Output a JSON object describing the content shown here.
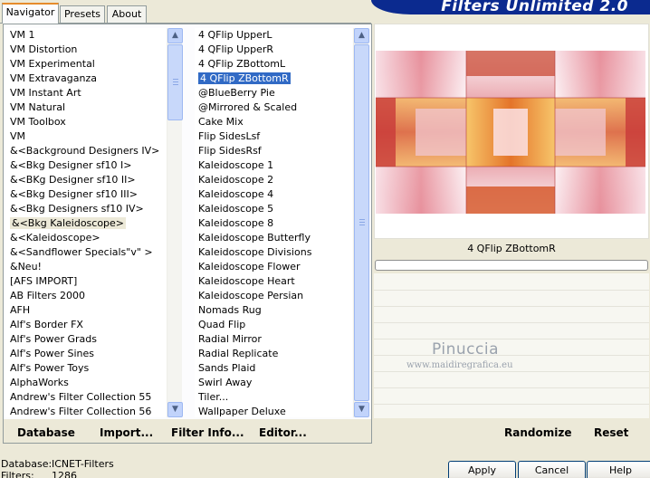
{
  "tabs": [
    "Navigator",
    "Presets",
    "About"
  ],
  "banner_title": "Filters Unlimited 2.0",
  "categories": [
    "VM 1",
    "VM Distortion",
    "VM Experimental",
    "VM Extravaganza",
    "VM Instant Art",
    "VM Natural",
    "VM Toolbox",
    "VM",
    "&<Background Designers IV>",
    "&<Bkg Designer sf10 I>",
    "&<BKg Designer sf10 II>",
    "&<Bkg Designer sf10 III>",
    "&<Bkg Designers sf10 IV>",
    "&<Bkg Kaleidoscope>",
    "&<Kaleidoscope>",
    "&<Sandflower Specials\"v\" >",
    "&Neu!",
    "[AFS IMPORT]",
    "AB Filters 2000",
    "AFH",
    "Alf's Border FX",
    "Alf's Power Grads",
    "Alf's Power Sines",
    "Alf's Power Toys",
    "AlphaWorks",
    "Andrew's Filter Collection 55",
    "Andrew's Filter Collection 56"
  ],
  "selected_category": "&<Bkg Kaleidoscope>",
  "filters": [
    "4 QFlip UpperL",
    "4 QFlip UpperR",
    "4 QFlip ZBottomL",
    "4 QFlip ZBottomR",
    "@BlueBerry Pie",
    "@Mirrored & Scaled",
    "Cake Mix",
    "Flip SidesLsf",
    "Flip SidesRsf",
    "Kaleidoscope 1",
    "Kaleidoscope 2",
    "Kaleidoscope 4",
    "Kaleidoscope 5",
    "Kaleidoscope 8",
    "Kaleidoscope Butterfly",
    "Kaleidoscope Divisions",
    "Kaleidoscope Flower",
    "Kaleidoscope Heart",
    "Kaleidoscope Persian",
    "Nomads Rug",
    "Quad Flip",
    "Radial Mirror",
    "Radial Replicate",
    "Sands Plaid",
    "Swirl Away",
    "Tiler...",
    "Wallpaper Deluxe"
  ],
  "selected_filter": "4 QFlip ZBottomR",
  "left_buttons": {
    "database": "Database",
    "import": "Import...",
    "filter_info": "Filter Info...",
    "editor": "Editor..."
  },
  "preview": {
    "filter_name": "4 QFlip ZBottomR",
    "watermark_name": "Pinuccia",
    "watermark_url": "www.maidiregrafica.eu",
    "colors": {
      "orange": "#e8842a",
      "red": "#c83a3a",
      "pink": "#f2c8d2",
      "white": "#ffffff"
    }
  },
  "right_buttons": {
    "randomize": "Randomize",
    "reset": "Reset"
  },
  "status": {
    "database_label": "Database:",
    "database_value": "ICNET-Filters",
    "filters_label": "Filters:",
    "filters_value": "1286"
  },
  "dialog_buttons": {
    "apply": "Apply",
    "cancel": "Cancel",
    "help": "Help"
  }
}
